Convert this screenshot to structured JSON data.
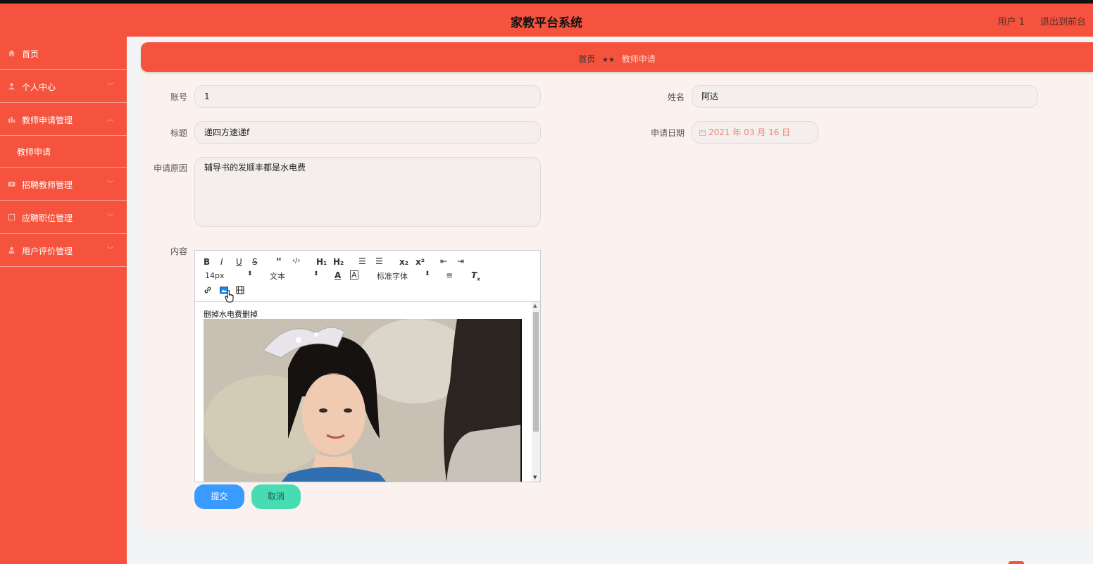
{
  "header": {
    "title": "家教平台系统",
    "user": "用户 1",
    "logout": "退出到前台"
  },
  "sidebar": {
    "items": [
      {
        "label": "首页",
        "icon": "home-icon"
      },
      {
        "label": "个人中心",
        "icon": "user-icon"
      },
      {
        "label": "教师申请管理",
        "icon": "bar-chart-icon"
      },
      {
        "label": "招聘教师管理",
        "icon": "ticket-icon"
      },
      {
        "label": "应聘职位管理",
        "icon": "square-icon"
      },
      {
        "label": "用户评价管理",
        "icon": "person-icon"
      }
    ],
    "submenu": "教师申请"
  },
  "breadcrumb": {
    "home": "首页",
    "separator": "★★",
    "current": "教师申请"
  },
  "form": {
    "account_label": "账号",
    "account_value": "1",
    "name_label": "姓名",
    "name_value": "阿达",
    "title_label": "标题",
    "title_value": "递四方速递f",
    "date_label": "申请日期",
    "date_value": "2021 年 03 月 16 日",
    "reason_label": "申请原因",
    "reason_value": "辅导书的发顺丰都是水电费",
    "content_label": "内容",
    "content_text": "删掉水电费删掉",
    "submit": "提交",
    "cancel": "取消"
  },
  "editor": {
    "font_size": "14px",
    "text_style": "文本",
    "font_family": "标准字体"
  },
  "colors": {
    "primary": "#f5533d",
    "submit": "#3a9bff",
    "cancel": "#48dcb3"
  }
}
